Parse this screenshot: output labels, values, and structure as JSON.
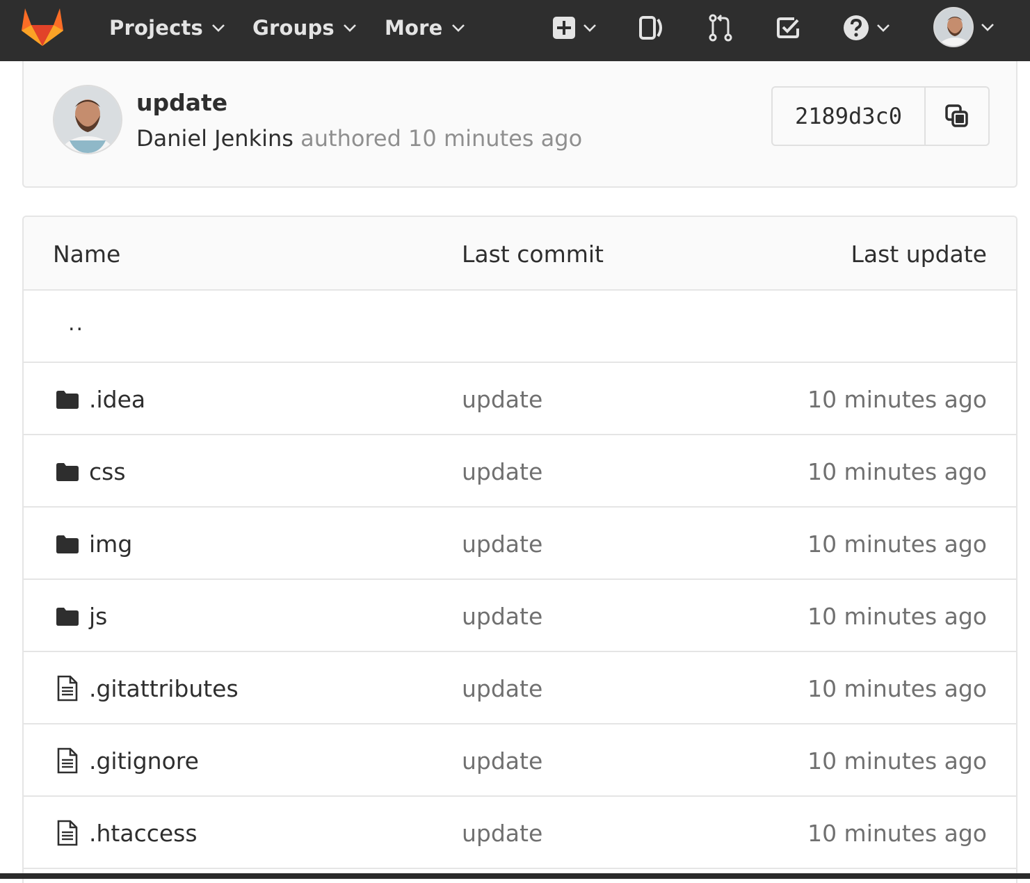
{
  "navbar": {
    "logo": "gitlab-tanuki-logo",
    "links": [
      {
        "label": "Projects"
      },
      {
        "label": "Groups"
      },
      {
        "label": "More"
      }
    ],
    "icons": [
      "plus-square-icon",
      "issues-icon",
      "merge-request-icon",
      "todo-check-icon",
      "help-question-icon",
      "user-avatar"
    ]
  },
  "commit": {
    "title": "update",
    "author": "Daniel Jenkins",
    "authored_text": "authored",
    "time": "10 minutes ago",
    "sha": "2189d3c0"
  },
  "table": {
    "headers": {
      "name": "Name",
      "last_commit": "Last commit",
      "last_update": "Last update"
    },
    "parent": "..",
    "rows": [
      {
        "name": ".idea",
        "type": "folder",
        "commit": "update",
        "updated": "10 minutes ago"
      },
      {
        "name": "css",
        "type": "folder",
        "commit": "update",
        "updated": "10 minutes ago"
      },
      {
        "name": "img",
        "type": "folder",
        "commit": "update",
        "updated": "10 minutes ago"
      },
      {
        "name": "js",
        "type": "folder",
        "commit": "update",
        "updated": "10 minutes ago"
      },
      {
        "name": ".gitattributes",
        "type": "file",
        "commit": "update",
        "updated": "10 minutes ago"
      },
      {
        "name": ".gitignore",
        "type": "file",
        "commit": "update",
        "updated": "10 minutes ago"
      },
      {
        "name": ".htaccess",
        "type": "file",
        "commit": "update",
        "updated": "10 minutes ago"
      }
    ]
  },
  "colors": {
    "navbar_bg": "#2e2e2e",
    "logo_orange": "#fc6d26",
    "logo_red": "#e24329",
    "muted_text": "#707070"
  }
}
